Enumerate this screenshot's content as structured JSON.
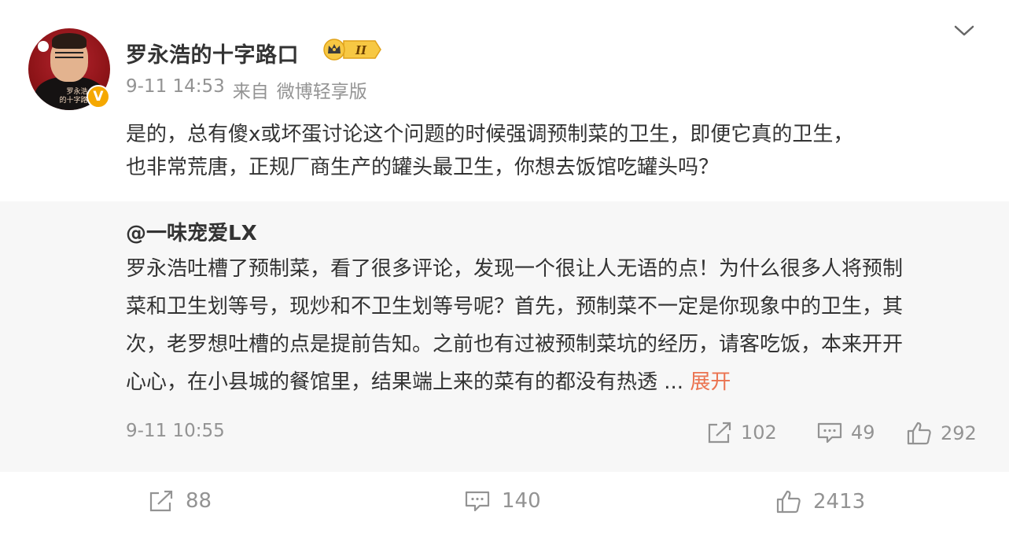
{
  "author": {
    "name": "罗永浩的十字路口",
    "avatar_caption_line1": "罗永浩",
    "avatar_caption_line2": "的十字路口",
    "verified_mark": "V",
    "level_badge": "II"
  },
  "post": {
    "date": "9-11 14:53",
    "source_prefix": "来自",
    "source": "微博轻享版",
    "text_line1": "是的，总有傻x或坏蛋讨论这个问题的时候强调预制菜的卫生，即便它真的卫生，",
    "text_line2": "也非常荒唐，正规厂商生产的罐头最卫生，你想去饭馆吃罐头吗？"
  },
  "repost": {
    "user": "@一味宠爱LX",
    "text_line1": "罗永浩吐槽了预制菜，看了很多评论，发现一个很让人无语的点！为什么很多人将预制",
    "text_line2": "菜和卫生划等号，现炒和不卫生划等号呢？首先，预制菜不一定是你现象中的卫生，其",
    "text_line3": "次，老罗想吐槽的点是提前告知。之前也有过被预制菜坑的经历，请客吃饭，本来开开",
    "text_line4": "心心，在小县城的餐馆里，结果端上来的菜有的都没有热透 ...",
    "expand_label": "展开",
    "time": "9-11 10:55",
    "reposts": "102",
    "comments": "49",
    "likes": "292"
  },
  "actions": {
    "reposts": "88",
    "comments": "140",
    "likes": "2413"
  },
  "colors": {
    "text": "#333333",
    "meta": "#939393",
    "link": "#eb7350",
    "repost_bg": "#f7f7f7",
    "badge_gold": "#f5a800"
  },
  "icons": [
    "chevron-down-icon",
    "repost-icon",
    "comment-icon",
    "like-icon",
    "vip-crown-icon",
    "verified-icon"
  ]
}
